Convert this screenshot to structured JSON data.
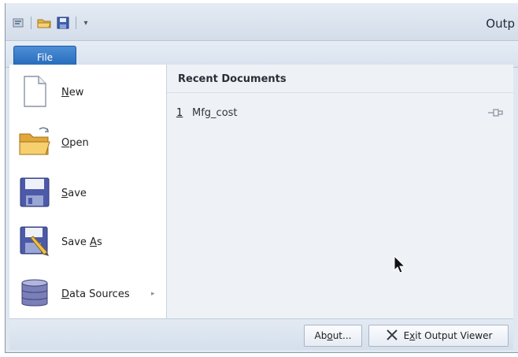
{
  "window": {
    "title": "Outp"
  },
  "quick_access": {
    "icons": [
      "properties-icon",
      "open-folder-icon",
      "save-icon"
    ],
    "dropdown_glyph": "▾"
  },
  "tabs": {
    "file_label": "File"
  },
  "menu": {
    "items": [
      {
        "label_u": "N",
        "label_rest": "ew",
        "icon": "new-document-icon"
      },
      {
        "label_u": "O",
        "label_rest": "pen",
        "icon": "open-folder-icon"
      },
      {
        "label_u": "S",
        "label_rest": "ave",
        "icon": "save-icon"
      },
      {
        "label_pre": "Save ",
        "label_u": "A",
        "label_rest": "s",
        "icon": "save-as-icon"
      },
      {
        "label_u": "D",
        "label_rest": "ata Sources",
        "icon": "database-icon",
        "submenu_glyph": "▸"
      }
    ]
  },
  "recent": {
    "header": "Recent Documents",
    "items": [
      {
        "number": "1",
        "name": "Mfg_cost"
      }
    ]
  },
  "footer": {
    "about_pre": "Ab",
    "about_u": "o",
    "about_rest": "ut...",
    "exit_pre": "E",
    "exit_u": "x",
    "exit_rest": "it Output Viewer"
  },
  "colors": {
    "file_tab": "#2f74c4",
    "menu_bg": "#ffffff",
    "panel_bg": "#eef2f7"
  }
}
